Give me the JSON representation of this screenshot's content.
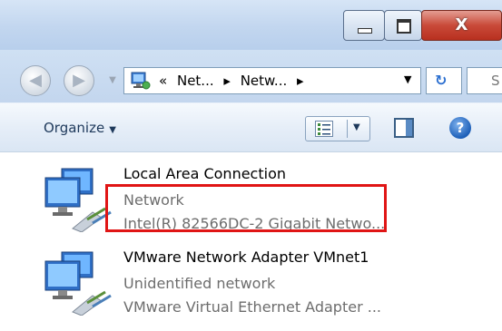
{
  "window": {
    "minimize_symbol": "",
    "maximize_symbol": "",
    "close_symbol": "X"
  },
  "nav": {
    "back_symbol": "◀",
    "forward_symbol": "▶",
    "breadcrumb_overflow": "«",
    "breadcrumb": [
      "Net...",
      "Netw..."
    ],
    "separator": "▸",
    "dropdown_symbol": "▼",
    "refresh_symbol": "↻",
    "search_partial": "S"
  },
  "toolbar": {
    "organize_label": "Organize",
    "organize_caret": "▼",
    "view_caret": "▼",
    "help_symbol": "?"
  },
  "adapters": [
    {
      "name": "Local Area Connection",
      "status": "Network",
      "device": "Intel(R) 82566DC-2 Gigabit Netwo..."
    },
    {
      "name": "VMware Network Adapter VMnet1",
      "status": "Unidentified network",
      "device": "VMware Virtual Ethernet Adapter ..."
    }
  ],
  "colors": {
    "highlight_box": "#e01515",
    "status_text": "#6d6d6d",
    "toolbar_text": "#1e395b"
  },
  "icons": [
    "network-adapter-icon",
    "network-folder-icon",
    "view-options-icon",
    "preview-pane-icon",
    "help-icon"
  ]
}
